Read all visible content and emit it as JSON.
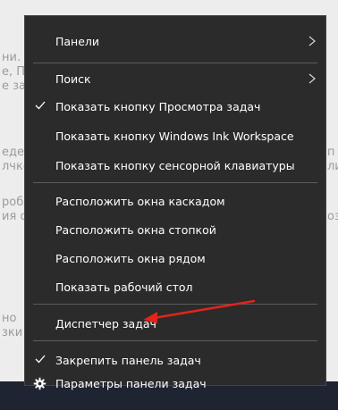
{
  "background": {
    "fragments": [
      "ни.",
      "е, П",
      "е за",
      "еде",
      "лчко",
      "робл",
      "ия с",
      "но",
      "зки",
      "п",
      "ли",
      "оз"
    ]
  },
  "menu": {
    "items": [
      {
        "label": "Панели",
        "submenu": true
      },
      {
        "label": "Поиск",
        "submenu": true
      },
      {
        "label": "Показать кнопку Просмотра задач",
        "checked": true
      },
      {
        "label": "Показать кнопку Windows Ink Workspace"
      },
      {
        "label": "Показать кнопку сенсорной клавиатуры"
      },
      {
        "label": "Расположить окна каскадом"
      },
      {
        "label": "Расположить окна стопкой"
      },
      {
        "label": "Расположить окна рядом"
      },
      {
        "label": "Показать рабочий стол"
      },
      {
        "label": "Диспетчер задач"
      },
      {
        "label": "Закрепить панель задач",
        "checked": true
      },
      {
        "label": "Параметры панели задач",
        "icon": "gear-icon"
      }
    ]
  },
  "annotation": {
    "arrow_color": "#e0251b"
  }
}
